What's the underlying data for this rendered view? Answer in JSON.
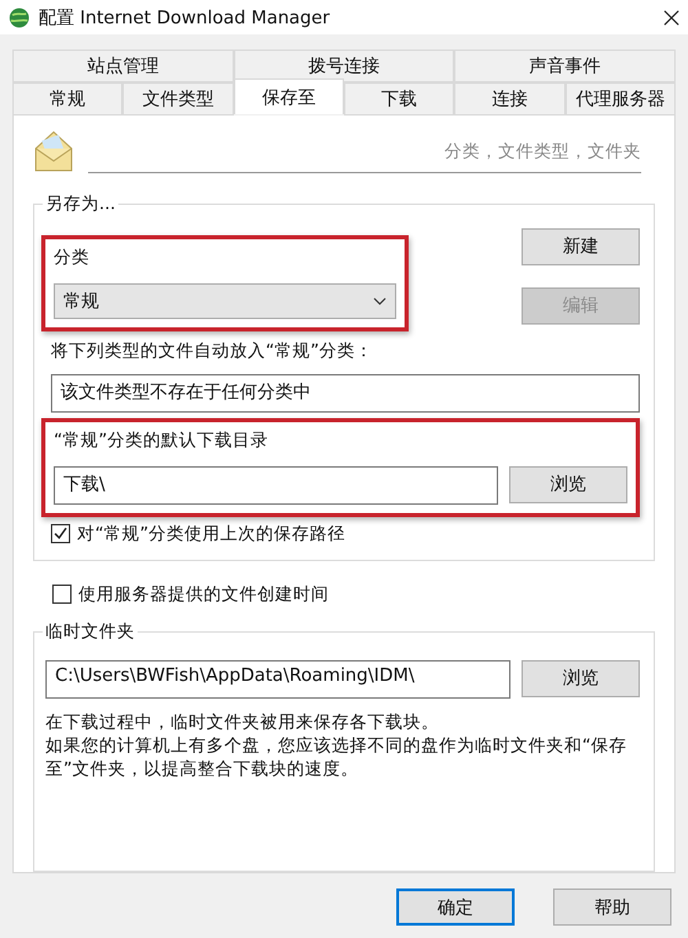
{
  "window": {
    "title": "配置 Internet Download Manager"
  },
  "tab_rows": [
    [
      {
        "label": "站点管理",
        "selected": false
      },
      {
        "label": "拨号连接",
        "selected": false
      },
      {
        "label": "声音事件",
        "selected": false
      }
    ],
    [
      {
        "label": "常规",
        "selected": false
      },
      {
        "label": "文件类型",
        "selected": false
      },
      {
        "label": "保存至",
        "selected": true
      },
      {
        "label": "下载",
        "selected": false
      },
      {
        "label": "连接",
        "selected": false
      },
      {
        "label": "代理服务器",
        "selected": false
      }
    ]
  ],
  "header": {
    "caption": "分类，文件类型，文件夹"
  },
  "save_as": {
    "title": "另存为...",
    "category": {
      "label": "分类",
      "value": "常规",
      "highlighted": true
    },
    "new_button": {
      "label": "新建",
      "disabled": false
    },
    "edit_button": {
      "label": "编辑",
      "disabled": true
    },
    "types_label": "将下列类型的文件自动放入“常规”分类：",
    "types_value": "该文件类型不存在于任何分类中",
    "default_dir": {
      "label": "“常规”分类的默认下载目录",
      "value": "下载\\",
      "button": "浏览",
      "highlighted": true
    },
    "last_path": {
      "label": "对“常规”分类使用上次的保存路径",
      "checked": true
    }
  },
  "server_time": {
    "label": "使用服务器提供的文件创建时间",
    "checked": false
  },
  "temp": {
    "title": "临时文件夹",
    "value": "C:\\Users\\BWFish\\AppData\\Roaming\\IDM\\",
    "button": "浏览",
    "notes": [
      "在下载过程中，临时文件夹被用来保存各下载块。",
      "如果您的计算机上有多个盘，您应该选择不同的盘作为临时文件夹和“保存至”文件夹，以提高整合下载块的速度。"
    ]
  },
  "buttons": [
    {
      "label": "确定",
      "default": true
    },
    {
      "label": "帮助",
      "default": false
    }
  ]
}
